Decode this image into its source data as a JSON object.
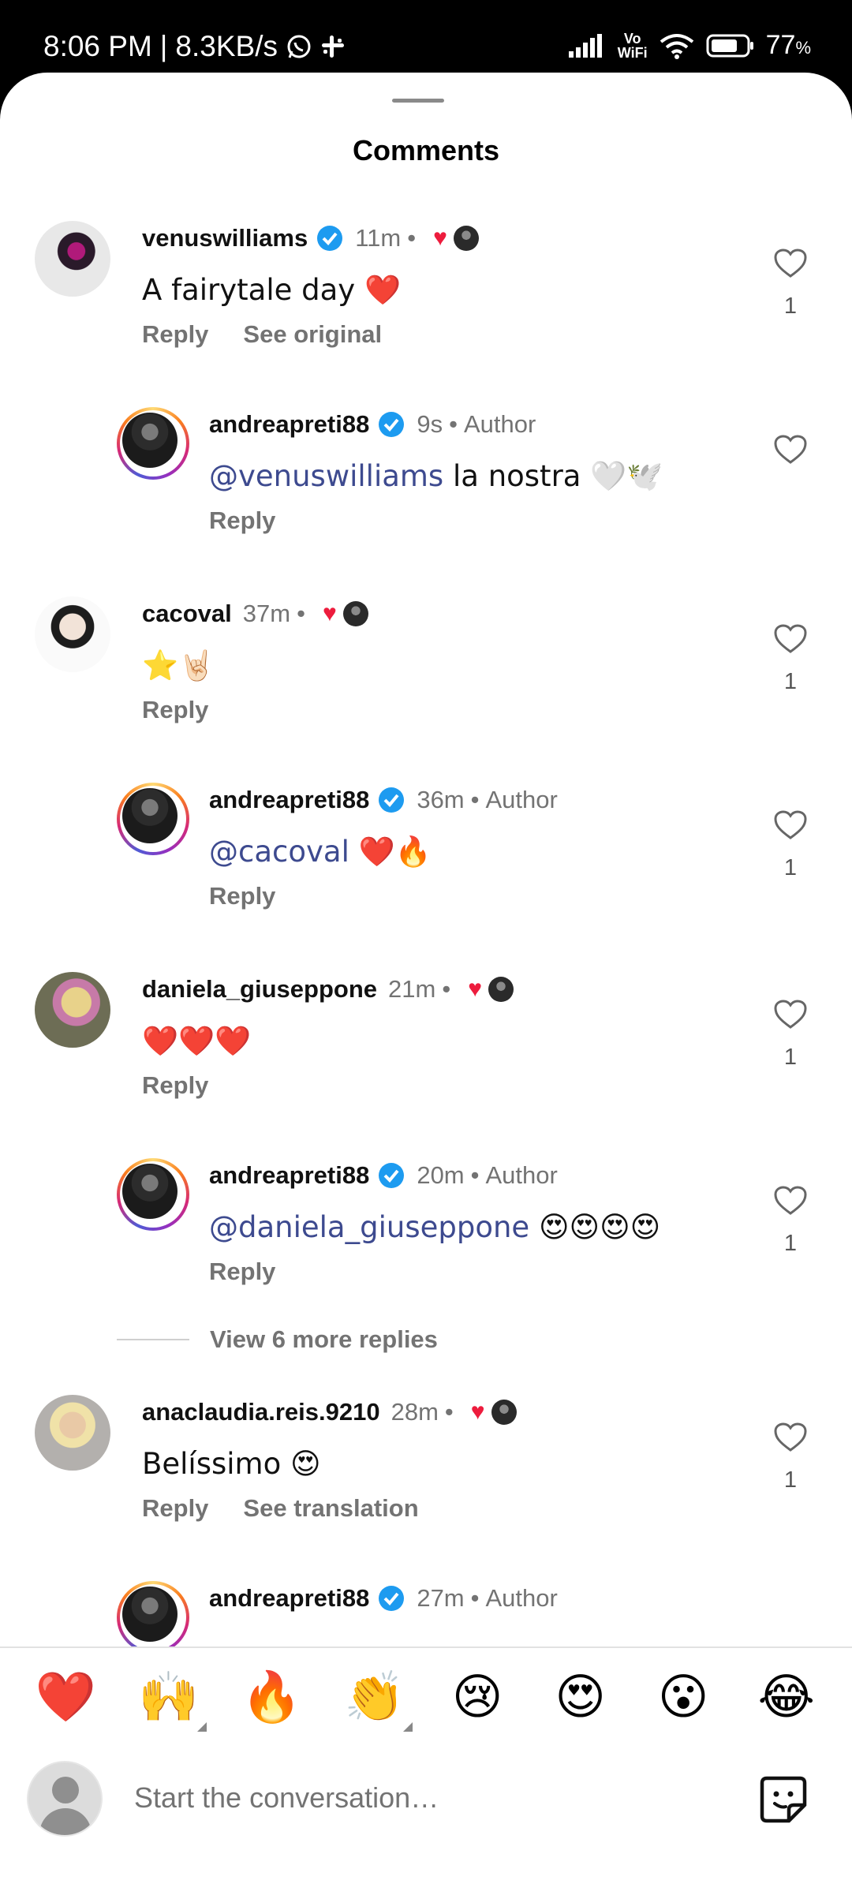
{
  "status_bar": {
    "time": "8:06 PM",
    "net_speed": "8.3KB/s",
    "battery": "77",
    "battery_unit": "%",
    "vowifi_top": "Vo",
    "vowifi_bottom": "WiFi"
  },
  "sheet": {
    "title": "Comments"
  },
  "comments": [
    {
      "user": "venuswilliams",
      "verified": true,
      "time": "11m",
      "text": "A fairytale day ❤️",
      "actions": [
        "Reply",
        "See original"
      ],
      "likes": "1"
    },
    {
      "user": "andreapreti88",
      "verified": true,
      "time": "9s",
      "author_label": "Author",
      "mention": "@venuswilliams",
      "text": " la nostra 🤍🕊️",
      "actions": [
        "Reply"
      ],
      "likes": ""
    },
    {
      "user": "cacoval",
      "verified": false,
      "time": "37m",
      "text": "⭐🤘🏻",
      "actions": [
        "Reply"
      ],
      "likes": "1"
    },
    {
      "user": "andreapreti88",
      "verified": true,
      "time": "36m",
      "author_label": "Author",
      "mention": "@cacoval",
      "text": " ❤️🔥",
      "actions": [
        "Reply"
      ],
      "likes": "1"
    },
    {
      "user": "daniela_giuseppone",
      "verified": false,
      "time": "21m",
      "text": "❤️❤️❤️",
      "actions": [
        "Reply"
      ],
      "likes": "1"
    },
    {
      "user": "andreapreti88",
      "verified": true,
      "time": "20m",
      "author_label": "Author",
      "mention": "@daniela_giuseppone",
      "text": " 😍😍😍😍",
      "actions": [
        "Reply"
      ],
      "likes": "1"
    },
    {
      "user": "anaclaudia.reis.9210",
      "verified": false,
      "time": "28m",
      "text": "Belíssimo 😍",
      "actions": [
        "Reply",
        "See translation"
      ],
      "likes": "1"
    },
    {
      "user": "andreapreti88",
      "verified": true,
      "time": "27m",
      "author_label": "Author"
    }
  ],
  "view_more": "View 6 more replies",
  "reactions": [
    "❤️",
    "🙌",
    "🔥",
    "👏",
    "😢",
    "😍",
    "😮",
    "😂"
  ],
  "composer": {
    "placeholder": "Start the conversation…"
  },
  "colors": {
    "accent_mention": "#3d4a8f",
    "verified_blue": "#1d9bf0",
    "heart_red": "#ed1c3d"
  }
}
